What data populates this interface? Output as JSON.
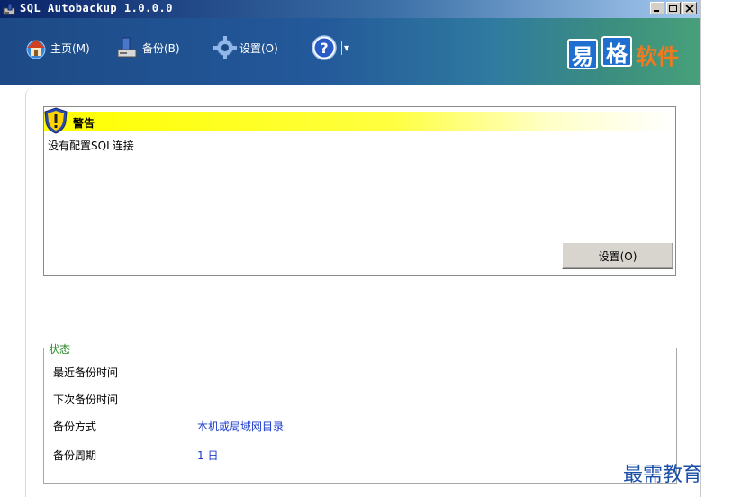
{
  "window": {
    "title": "SQL Autobackup 1.0.0.0"
  },
  "toolbar": {
    "home_label": "主页(M)",
    "backup_label": "备份(B)",
    "settings_label": "设置(O)",
    "help_dropdown": "▾"
  },
  "logo": {
    "part1": "易",
    "part2": "格",
    "part3": "软件"
  },
  "warning": {
    "title": "警告",
    "message": "没有配置SQL连接",
    "button": "设置(O)"
  },
  "status": {
    "legend": "状态",
    "rows": [
      {
        "label": "最近备份时间",
        "value": ""
      },
      {
        "label": "下次备份时间",
        "value": ""
      },
      {
        "label": "备份方式",
        "value": "本机或局域网目录"
      },
      {
        "label": "备份周期",
        "value": "1 日"
      }
    ]
  },
  "watermark": "最需教育",
  "colors": {
    "toolbar_start": "#1d4a86",
    "toolbar_end": "#47a07a",
    "warning_bar": "#ffff00",
    "status_legend": "#2a8a2a",
    "value_text": "#1a3acc",
    "logo_blue": "#1f6fd0",
    "logo_orange": "#f07a20"
  }
}
